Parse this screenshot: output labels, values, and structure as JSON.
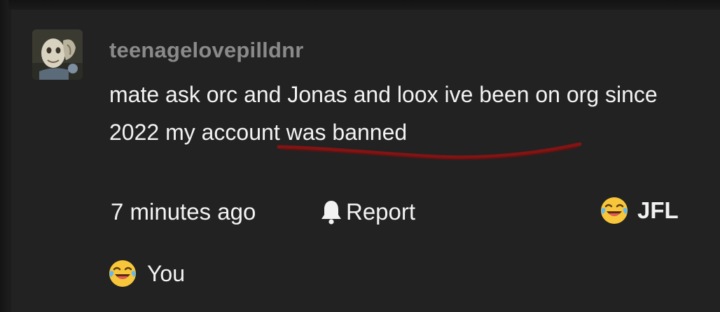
{
  "comment": {
    "username": "teenagelovepilldnr",
    "text": "mate ask orc and Jonas and loox ive been on org since 2022 my account was banned",
    "time": "7 minutes ago",
    "report_label": "Report",
    "reaction_label": "JFL",
    "reacted_by_label": "You"
  },
  "icons": {
    "avatar": "avatar-image",
    "report": "bell-icon",
    "reaction": "crying-laughing-emoji-icon",
    "reacted": "crying-laughing-emoji-icon"
  },
  "colors": {
    "background": "#222222",
    "text": "#f2f2f2",
    "username": "#8a8a8a",
    "underline_mark": "#8b1414"
  }
}
